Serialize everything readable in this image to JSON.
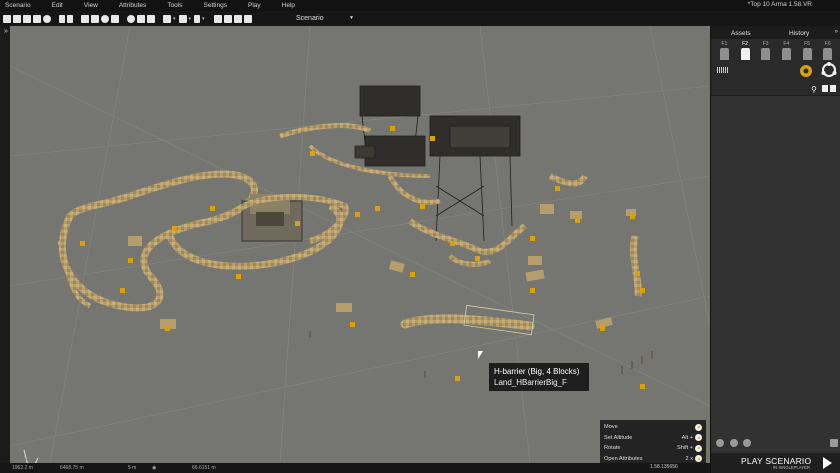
{
  "window": {
    "title": "*Top 10 Arma 1.58.VR"
  },
  "menu": [
    "Scenario",
    "Edit",
    "View",
    "Attributes",
    "Tools",
    "Settings",
    "Play",
    "Help"
  ],
  "toolbar": {
    "mode": "Scenario"
  },
  "tooltip": {
    "name": "H-barrier (Big, 4 Blocks)",
    "class": "Land_HBarrierBig_F"
  },
  "shortcuts": [
    {
      "action": "Move",
      "key": ""
    },
    {
      "action": "Set Altitude",
      "key": "Alt +"
    },
    {
      "action": "Rotate",
      "key": "Shift +"
    },
    {
      "action": "Open Attributes",
      "key": "2 x"
    }
  ],
  "statusbar": {
    "grid": "1962.2 m",
    "pos": "6468.75 m",
    "dist": "5 m",
    "view": "66.6151 m"
  },
  "right_panel": {
    "tabs": [
      "Assets",
      "History"
    ],
    "categories": [
      "F1",
      "F2",
      "F3",
      "F4",
      "F5",
      "F6"
    ],
    "active_category": "F2"
  },
  "play": {
    "label": "PLAY SCENARIO",
    "sub": "IN SINGLEPLAYER",
    "version": "1.58.135656"
  },
  "colors": {
    "terrain": "#757672",
    "panel": "#2a2a2a",
    "accent": "#f5a300",
    "barrier": "#b09a6a"
  }
}
